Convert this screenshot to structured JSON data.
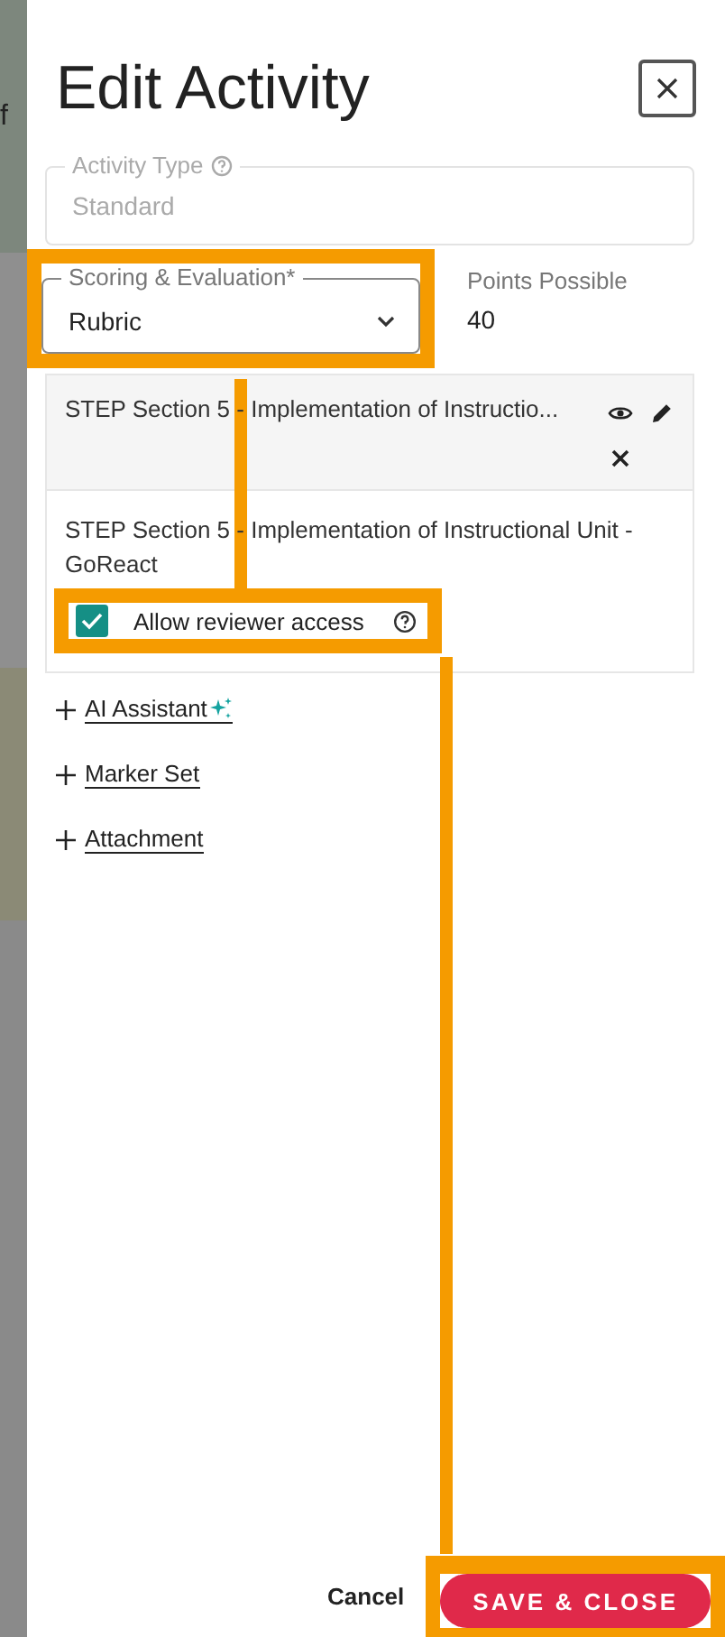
{
  "backdrop": {
    "text": "f"
  },
  "title": "Edit Activity",
  "activity_type": {
    "label": "Activity Type",
    "value": "Standard",
    "disabled": true
  },
  "scoring": {
    "label": "Scoring & Evaluation*",
    "value": "Rubric",
    "highlighted": true
  },
  "points": {
    "label": "Points Possible",
    "value": "40"
  },
  "rubric": {
    "header": "STEP Section 5 - Implementation of Instructio...",
    "body": "STEP Section 5 - Implementation of Instructional Unit - GoReact",
    "reviewer_access": {
      "label": "Allow reviewer access",
      "checked": true,
      "highlighted": true
    }
  },
  "add_links": [
    {
      "label": "AI Assistant",
      "sparkle": true
    },
    {
      "label": "Marker Set",
      "sparkle": false
    },
    {
      "label": "Attachment",
      "sparkle": false
    }
  ],
  "footer": {
    "cancel": "Cancel",
    "save": "SAVE & CLOSE",
    "save_highlighted": true
  }
}
